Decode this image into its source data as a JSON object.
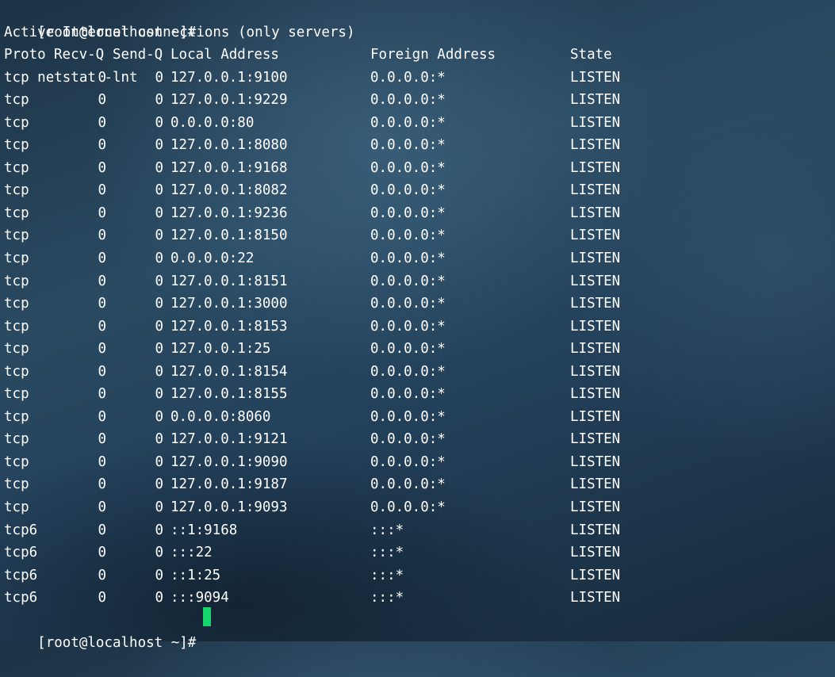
{
  "terminal": {
    "prompt": "[root@localhost ~]#",
    "command": "netstat -lnt",
    "heading": "Active Internet connections (only servers)",
    "columns": {
      "proto": "Proto",
      "recv_q": "Recv-Q",
      "send_q": "Send-Q",
      "local": "Local Address",
      "foreign": "Foreign Address",
      "state": "State"
    },
    "rows": [
      {
        "proto": "tcp",
        "recv_q": "0",
        "send_q": "0",
        "local": "127.0.0.1:9100",
        "foreign": "0.0.0.0:*",
        "state": "LISTEN"
      },
      {
        "proto": "tcp",
        "recv_q": "0",
        "send_q": "0",
        "local": "127.0.0.1:9229",
        "foreign": "0.0.0.0:*",
        "state": "LISTEN"
      },
      {
        "proto": "tcp",
        "recv_q": "0",
        "send_q": "0",
        "local": "0.0.0.0:80",
        "foreign": "0.0.0.0:*",
        "state": "LISTEN"
      },
      {
        "proto": "tcp",
        "recv_q": "0",
        "send_q": "0",
        "local": "127.0.0.1:8080",
        "foreign": "0.0.0.0:*",
        "state": "LISTEN"
      },
      {
        "proto": "tcp",
        "recv_q": "0",
        "send_q": "0",
        "local": "127.0.0.1:9168",
        "foreign": "0.0.0.0:*",
        "state": "LISTEN"
      },
      {
        "proto": "tcp",
        "recv_q": "0",
        "send_q": "0",
        "local": "127.0.0.1:8082",
        "foreign": "0.0.0.0:*",
        "state": "LISTEN"
      },
      {
        "proto": "tcp",
        "recv_q": "0",
        "send_q": "0",
        "local": "127.0.0.1:9236",
        "foreign": "0.0.0.0:*",
        "state": "LISTEN"
      },
      {
        "proto": "tcp",
        "recv_q": "0",
        "send_q": "0",
        "local": "127.0.0.1:8150",
        "foreign": "0.0.0.0:*",
        "state": "LISTEN"
      },
      {
        "proto": "tcp",
        "recv_q": "0",
        "send_q": "0",
        "local": "0.0.0.0:22",
        "foreign": "0.0.0.0:*",
        "state": "LISTEN"
      },
      {
        "proto": "tcp",
        "recv_q": "0",
        "send_q": "0",
        "local": "127.0.0.1:8151",
        "foreign": "0.0.0.0:*",
        "state": "LISTEN"
      },
      {
        "proto": "tcp",
        "recv_q": "0",
        "send_q": "0",
        "local": "127.0.0.1:3000",
        "foreign": "0.0.0.0:*",
        "state": "LISTEN"
      },
      {
        "proto": "tcp",
        "recv_q": "0",
        "send_q": "0",
        "local": "127.0.0.1:8153",
        "foreign": "0.0.0.0:*",
        "state": "LISTEN"
      },
      {
        "proto": "tcp",
        "recv_q": "0",
        "send_q": "0",
        "local": "127.0.0.1:25",
        "foreign": "0.0.0.0:*",
        "state": "LISTEN"
      },
      {
        "proto": "tcp",
        "recv_q": "0",
        "send_q": "0",
        "local": "127.0.0.1:8154",
        "foreign": "0.0.0.0:*",
        "state": "LISTEN"
      },
      {
        "proto": "tcp",
        "recv_q": "0",
        "send_q": "0",
        "local": "127.0.0.1:8155",
        "foreign": "0.0.0.0:*",
        "state": "LISTEN"
      },
      {
        "proto": "tcp",
        "recv_q": "0",
        "send_q": "0",
        "local": "0.0.0.0:8060",
        "foreign": "0.0.0.0:*",
        "state": "LISTEN"
      },
      {
        "proto": "tcp",
        "recv_q": "0",
        "send_q": "0",
        "local": "127.0.0.1:9121",
        "foreign": "0.0.0.0:*",
        "state": "LISTEN"
      },
      {
        "proto": "tcp",
        "recv_q": "0",
        "send_q": "0",
        "local": "127.0.0.1:9090",
        "foreign": "0.0.0.0:*",
        "state": "LISTEN"
      },
      {
        "proto": "tcp",
        "recv_q": "0",
        "send_q": "0",
        "local": "127.0.0.1:9187",
        "foreign": "0.0.0.0:*",
        "state": "LISTEN"
      },
      {
        "proto": "tcp",
        "recv_q": "0",
        "send_q": "0",
        "local": "127.0.0.1:9093",
        "foreign": "0.0.0.0:*",
        "state": "LISTEN"
      },
      {
        "proto": "tcp6",
        "recv_q": "0",
        "send_q": "0",
        "local": "::1:9168",
        "foreign": ":::*",
        "state": "LISTEN"
      },
      {
        "proto": "tcp6",
        "recv_q": "0",
        "send_q": "0",
        "local": ":::22",
        "foreign": ":::*",
        "state": "LISTEN"
      },
      {
        "proto": "tcp6",
        "recv_q": "0",
        "send_q": "0",
        "local": "::1:25",
        "foreign": ":::*",
        "state": "LISTEN"
      },
      {
        "proto": "tcp6",
        "recv_q": "0",
        "send_q": "0",
        "local": ":::9094",
        "foreign": ":::*",
        "state": "LISTEN"
      }
    ],
    "cursor_color": "#14d66b",
    "text_color": "#ffffff"
  }
}
